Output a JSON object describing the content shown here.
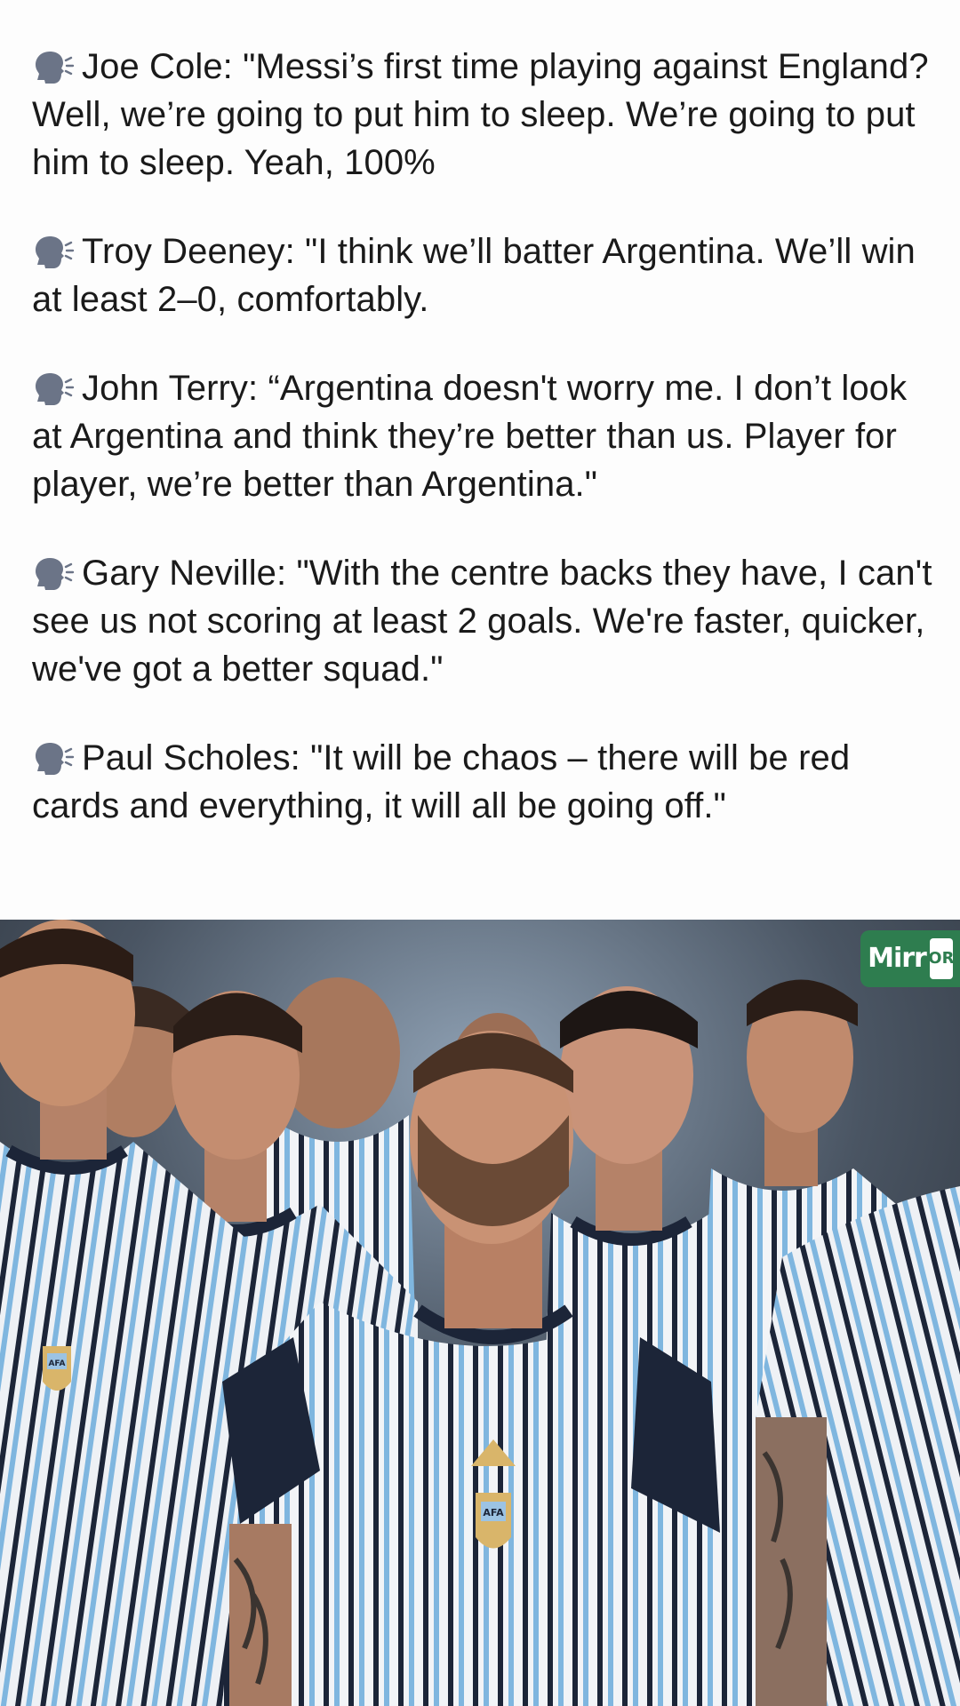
{
  "quotes": [
    {
      "icon": "speaking-head-icon",
      "text": "Joe Cole: \"Messi’s first time playing against England? Well, we’re going to put him to sleep. We’re going to put him to sleep. Yeah, 100%"
    },
    {
      "icon": "speaking-head-icon",
      "text": "Troy Deeney: \"I think we’ll batter Argentina. We’ll win at least 2–0, comfortably."
    },
    {
      "icon": "speaking-head-icon",
      "text": "John Terry: “Argentina doesn't worry me. I don’t look at Argentina and think they’re better than us. Player for player, we’re better than Argentina.\""
    },
    {
      "icon": "speaking-head-icon",
      "text": "Gary Neville: \"With the centre backs they have, I can't see us not scoring at least 2 goals. We're faster, quicker, we've got a better squad.\""
    },
    {
      "icon": "speaking-head-icon",
      "text": "Paul Scholes: \"It will be chaos – there will be red cards and everything, it will all be going off.\""
    }
  ],
  "photo": {
    "watermark_text": "Mirr",
    "watermark_sub": "OR",
    "crest_text": "AFA",
    "colors": {
      "stripe_blue": "#7fb6df",
      "stripe_dark": "#1c2538",
      "jersey_white": "#f2f4f7",
      "watermark_green": "#2e7d4f"
    }
  }
}
